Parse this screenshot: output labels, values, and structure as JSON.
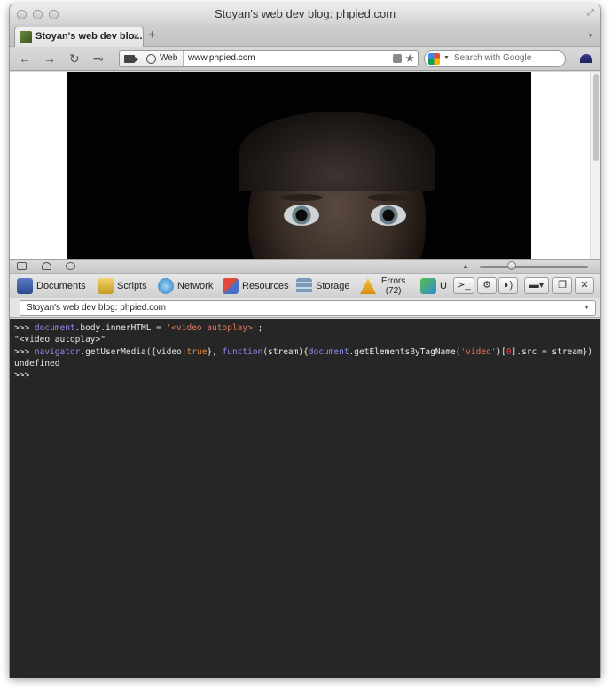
{
  "window": {
    "title": "Stoyan's web dev blog: phpied.com"
  },
  "tabs": [
    {
      "label": "Stoyan's web dev blo..."
    }
  ],
  "toolbar": {
    "mode_label": "Web",
    "url": "www.phpied.com",
    "search_placeholder": "Search with Google"
  },
  "devtools": {
    "panels": [
      {
        "label": "Documents",
        "icon": "documents-icon"
      },
      {
        "label": "Scripts",
        "icon": "scripts-icon"
      },
      {
        "label": "Network",
        "icon": "network-icon"
      },
      {
        "label": "Resources",
        "icon": "resources-icon"
      },
      {
        "label": "Storage",
        "icon": "storage-icon"
      },
      {
        "label": "Errors",
        "icon": "errors-icon",
        "count": "(72)"
      },
      {
        "label": "U",
        "icon": "utilities-icon"
      }
    ],
    "context": "Stoyan's web dev blog: phpied.com"
  },
  "console": {
    "prompt": ">>>",
    "lines": [
      {
        "type": "input",
        "segments": [
          {
            "t": "document",
            "c": "kw"
          },
          {
            "t": ".body.innerHTML = ",
            "c": "plain"
          },
          {
            "t": "'<video autoplay>'",
            "c": "str"
          },
          {
            "t": ";",
            "c": "plain"
          }
        ]
      },
      {
        "type": "output",
        "text": "\"<video autoplay>\""
      },
      {
        "type": "input",
        "segments": [
          {
            "t": "navigator",
            "c": "kw"
          },
          {
            "t": ".getUserMedia({video:",
            "c": "plain"
          },
          {
            "t": "true",
            "c": "bool"
          },
          {
            "t": "}, ",
            "c": "plain"
          },
          {
            "t": "function",
            "c": "kw"
          },
          {
            "t": "(stream){",
            "c": "plain"
          },
          {
            "t": "document",
            "c": "kw"
          },
          {
            "t": ".getElementsByTagName(",
            "c": "plain"
          },
          {
            "t": "'video'",
            "c": "str"
          },
          {
            "t": ")[",
            "c": "plain"
          },
          {
            "t": "0",
            "c": "num"
          },
          {
            "t": "].src = stream})",
            "c": "plain"
          }
        ]
      },
      {
        "type": "output",
        "text": "undefined"
      },
      {
        "type": "input",
        "segments": []
      }
    ]
  },
  "colors": {
    "console_bg": "#262626",
    "keyword": "#8c8ce8",
    "string": "#e07a5f",
    "boolean": "#e38a3c",
    "number": "#e04b4b"
  }
}
